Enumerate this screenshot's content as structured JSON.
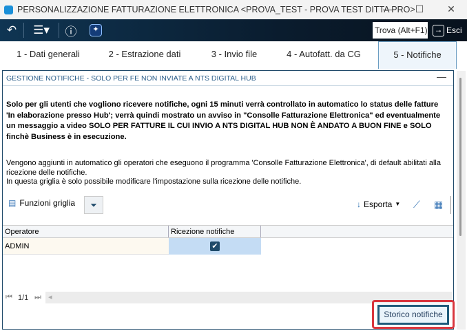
{
  "window": {
    "title": "PERSONALIZZAZIONE FATTURAZIONE ELETTRONICA <PROVA_TEST - PROVA TEST DITTA PRO>"
  },
  "toolbar": {
    "find_label": "Trova (Alt+F1)",
    "exit_label": "Esci"
  },
  "tabs": [
    {
      "label": "1 - Dati generali"
    },
    {
      "label": "2 - Estrazione dati"
    },
    {
      "label": "3 - Invio file"
    },
    {
      "label": "4 - Autofatt. da CG"
    },
    {
      "label": "5 - Notifiche"
    }
  ],
  "panel": {
    "title": "GESTIONE NOTIFICHE - SOLO PER FE NON INVIATE A NTS DIGITAL HUB",
    "bold_text": "Solo per gli utenti che vogliono ricevere notifiche, ogni 15 minuti verrà controllato in automatico lo status delle fatture 'In elaborazione presso Hub'; verrà quindi mostrato un avviso in \"Consolle Fatturazione Elettronica\" ed eventualmente un messaggio a video SOLO PER FATTURE IL CUI INVIO A NTS DIGITAL HUB NON È ANDATO A BUON FINE e SOLO finchè Business è in esecuzione.",
    "info_line1": "Vengono aggiunti in automatico gli operatori che eseguono il programma 'Consolle Fatturazione Elettronica', di default abilitati alla ricezione delle notifiche.",
    "info_line2": "In questa griglia è solo possibile modificare l'impostazione sulla ricezione delle notifiche."
  },
  "grid": {
    "functions_label": "Funzioni griglia",
    "export_label": "Esporta",
    "columns": [
      "Operatore",
      "Ricezione notifiche"
    ],
    "rows": [
      {
        "operatore": "ADMIN",
        "ricezione": true
      }
    ],
    "pager": "1/1"
  },
  "actions": {
    "history_button": "Storico notifiche"
  }
}
